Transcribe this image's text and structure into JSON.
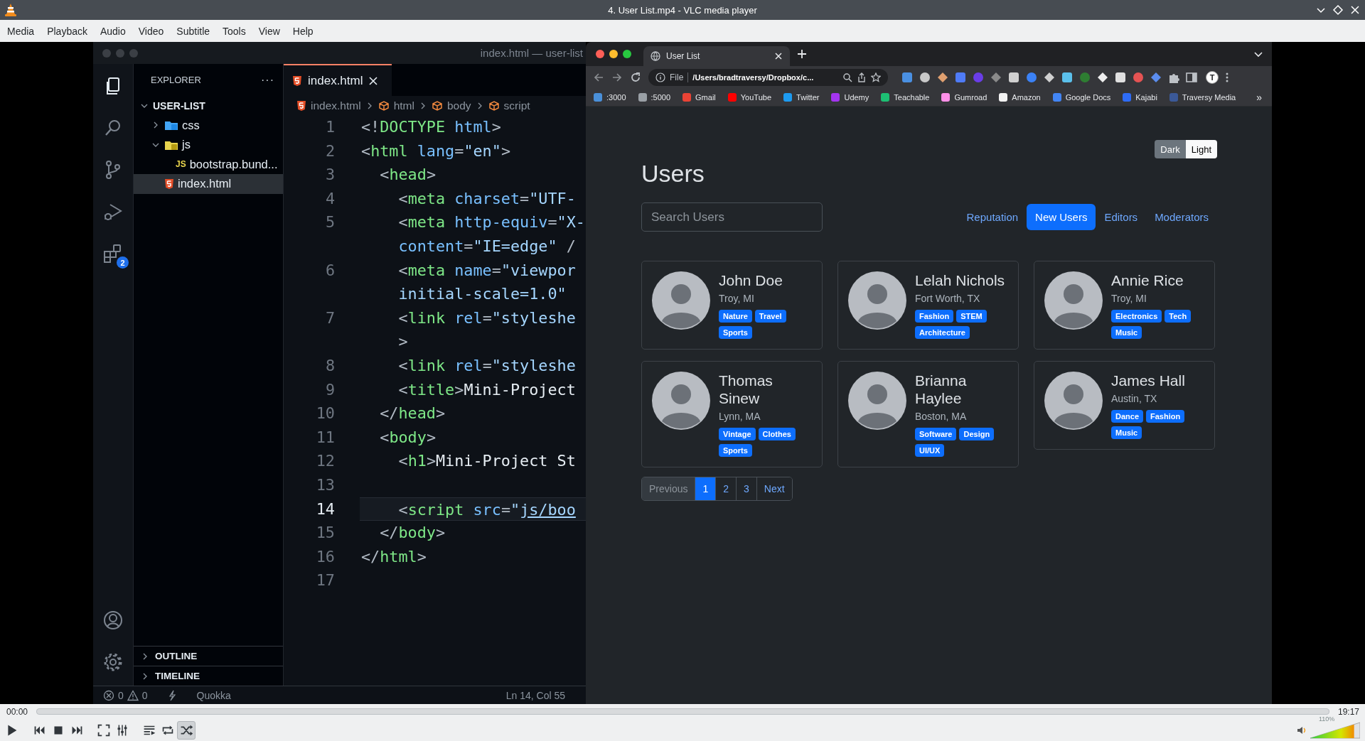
{
  "window": {
    "title": "4. User List.mp4 - VLC media player"
  },
  "menu": [
    "Media",
    "Playback",
    "Audio",
    "Video",
    "Subtitle",
    "Tools",
    "View",
    "Help"
  ],
  "editor": {
    "title": "index.html — user-list",
    "activity": [
      {
        "kind": "explorer",
        "selected": true
      },
      {
        "kind": "search",
        "selected": false
      },
      {
        "kind": "source-control",
        "selected": false
      },
      {
        "kind": "run-debug",
        "selected": false
      },
      {
        "kind": "extensions",
        "selected": false,
        "badge": "2"
      },
      {
        "kind": "account",
        "selected": false
      },
      {
        "kind": "settings",
        "selected": false
      }
    ],
    "explorer_title": "EXPLORER",
    "more": "···",
    "tree": [
      {
        "label": "USER-LIST",
        "kind": "root",
        "expanded": true,
        "selected": false,
        "children": [
          {
            "label": "css",
            "kind": "css-folder",
            "expanded": false,
            "selected": false
          },
          {
            "label": "js",
            "kind": "js-folder",
            "expanded": true,
            "selected": false,
            "children": [
              {
                "label": "bootstrap.bund...",
                "kind": "js-file",
                "icon": "JS",
                "selected": false
              }
            ]
          },
          {
            "label": "index.html",
            "kind": "html-file",
            "selected": true
          }
        ]
      }
    ],
    "sections": [
      {
        "label": "OUTLINE",
        "expanded": false
      },
      {
        "label": "TIMELINE",
        "expanded": false
      }
    ],
    "tabs": [
      {
        "label": "index.html",
        "selected": true
      }
    ],
    "breadcrumb": [
      {
        "kind": "file",
        "label": "index.html"
      },
      {
        "kind": "element",
        "label": "html"
      },
      {
        "kind": "element",
        "label": "body"
      },
      {
        "kind": "element",
        "label": "script"
      }
    ],
    "lines": [
      {
        "number": "1",
        "current": false,
        "tokens": [
          {
            "kind": "punct",
            "text": "<!"
          },
          {
            "kind": "tag",
            "text": "DOCTYPE"
          },
          {
            "kind": "attr",
            "text": " html"
          },
          {
            "kind": "punct",
            "text": ">"
          }
        ]
      },
      {
        "number": "2",
        "current": false,
        "tokens": [
          {
            "kind": "punct",
            "text": "<"
          },
          {
            "kind": "tag",
            "text": "html"
          },
          {
            "kind": "attr",
            "text": " lang"
          },
          {
            "kind": "punct",
            "text": "="
          },
          {
            "kind": "string",
            "text": "\"en\""
          },
          {
            "kind": "punct",
            "text": ">"
          }
        ]
      },
      {
        "number": "3",
        "current": false,
        "tokens": [
          {
            "kind": "punct",
            "text": "  <"
          },
          {
            "kind": "tag",
            "text": "head"
          },
          {
            "kind": "punct",
            "text": ">"
          }
        ]
      },
      {
        "number": "4",
        "current": false,
        "tokens": [
          {
            "kind": "punct",
            "text": "    <"
          },
          {
            "kind": "tag",
            "text": "meta"
          },
          {
            "kind": "attr",
            "text": " charset"
          },
          {
            "kind": "punct",
            "text": "="
          },
          {
            "kind": "string",
            "text": "\"UTF-"
          }
        ]
      },
      {
        "number": "5",
        "current": false,
        "tokens": [
          {
            "kind": "punct",
            "text": "    <"
          },
          {
            "kind": "tag",
            "text": "meta"
          },
          {
            "kind": "attr",
            "text": " http-equiv"
          },
          {
            "kind": "punct",
            "text": "="
          },
          {
            "kind": "string",
            "text": "\"X-"
          }
        ]
      },
      {
        "current": false,
        "tokens": [
          {
            "kind": "attr",
            "text": "    content"
          },
          {
            "kind": "punct",
            "text": "="
          },
          {
            "kind": "string",
            "text": "\"IE=edge\""
          },
          {
            "kind": "punct",
            "text": " /"
          }
        ]
      },
      {
        "number": "6",
        "current": false,
        "tokens": [
          {
            "kind": "punct",
            "text": "    <"
          },
          {
            "kind": "tag",
            "text": "meta"
          },
          {
            "kind": "attr",
            "text": " name"
          },
          {
            "kind": "punct",
            "text": "="
          },
          {
            "kind": "string",
            "text": "\"viewpor"
          }
        ]
      },
      {
        "current": false,
        "tokens": [
          {
            "kind": "string",
            "text": "    initial-scale=1.0\""
          }
        ]
      },
      {
        "number": "7",
        "current": false,
        "tokens": [
          {
            "kind": "punct",
            "text": "    <"
          },
          {
            "kind": "tag",
            "text": "link"
          },
          {
            "kind": "attr",
            "text": " rel"
          },
          {
            "kind": "punct",
            "text": "="
          },
          {
            "kind": "string",
            "text": "\"styleshe"
          }
        ]
      },
      {
        "current": false,
        "tokens": [
          {
            "kind": "punct",
            "text": "    >"
          }
        ]
      },
      {
        "number": "8",
        "current": false,
        "tokens": [
          {
            "kind": "punct",
            "text": "    <"
          },
          {
            "kind": "tag",
            "text": "link"
          },
          {
            "kind": "attr",
            "text": " rel"
          },
          {
            "kind": "punct",
            "text": "="
          },
          {
            "kind": "string",
            "text": "\"styleshe"
          }
        ]
      },
      {
        "number": "9",
        "current": false,
        "tokens": [
          {
            "kind": "punct",
            "text": "    <"
          },
          {
            "kind": "tag",
            "text": "title"
          },
          {
            "kind": "punct",
            "text": ">"
          },
          {
            "kind": "text",
            "text": "Mini-Project"
          }
        ]
      },
      {
        "number": "10",
        "current": false,
        "tokens": [
          {
            "kind": "punct",
            "text": "  </"
          },
          {
            "kind": "tag",
            "text": "head"
          },
          {
            "kind": "punct",
            "text": ">"
          }
        ]
      },
      {
        "number": "11",
        "current": false,
        "tokens": [
          {
            "kind": "punct",
            "text": "  <"
          },
          {
            "kind": "tag",
            "text": "body"
          },
          {
            "kind": "punct",
            "text": ">"
          }
        ]
      },
      {
        "number": "12",
        "current": false,
        "tokens": [
          {
            "kind": "punct",
            "text": "    <"
          },
          {
            "kind": "tag",
            "text": "h1"
          },
          {
            "kind": "punct",
            "text": ">"
          },
          {
            "kind": "text",
            "text": "Mini-Project St"
          }
        ]
      },
      {
        "number": "13",
        "current": false
      },
      {
        "number": "14",
        "current": true,
        "tokens": [
          {
            "kind": "punct",
            "text": "    <"
          },
          {
            "kind": "tag",
            "text": "script"
          },
          {
            "kind": "attr",
            "text": " src"
          },
          {
            "kind": "punct",
            "text": "="
          },
          {
            "kind": "string",
            "text": "\""
          },
          {
            "kind": "link",
            "text": "js/boo"
          }
        ]
      },
      {
        "number": "15",
        "current": false,
        "tokens": [
          {
            "kind": "punct",
            "text": "  </"
          },
          {
            "kind": "tag",
            "text": "body"
          },
          {
            "kind": "punct",
            "text": ">"
          }
        ]
      },
      {
        "number": "16",
        "current": false,
        "tokens": [
          {
            "kind": "punct",
            "text": "</"
          },
          {
            "kind": "tag",
            "text": "html"
          },
          {
            "kind": "punct",
            "text": ">"
          }
        ]
      },
      {
        "number": "17",
        "current": false
      }
    ],
    "status": {
      "errors": "0",
      "warnings": "0",
      "extension": "Quokka",
      "position": "Ln 14, Col 55"
    }
  },
  "browser": {
    "tabs": [
      {
        "title": "User List",
        "selected": true
      }
    ],
    "address": {
      "scheme": "File",
      "url": "/Users/bradtraversy/Dropbox/c..."
    },
    "profile": "T",
    "bookmarks": [
      {
        "label": ":3000",
        "color": "#4a90d9"
      },
      {
        "label": ":5000",
        "color": "#9aa0a6"
      },
      {
        "label": "Gmail",
        "color": "#ea4335"
      },
      {
        "label": "YouTube",
        "color": "#ff0000"
      },
      {
        "label": "Twitter",
        "color": "#1d9bf0"
      },
      {
        "label": "Udemy",
        "color": "#a435f0"
      },
      {
        "label": "Teachable",
        "color": "#1dbf73"
      },
      {
        "label": "Gumroad",
        "color": "#ff90e8"
      },
      {
        "label": "Amazon",
        "color": "#f2f2f2"
      },
      {
        "label": "Google Docs",
        "color": "#4285f4"
      },
      {
        "label": "Kajabi",
        "color": "#2e6cf6"
      },
      {
        "label": "Traversy Media",
        "color": "#3b5998"
      }
    ],
    "bookmarks_more": "»",
    "page": {
      "theme_toggle": [
        {
          "label": "Dark",
          "kind": "secondary"
        },
        {
          "label": "Light",
          "kind": "light"
        }
      ],
      "heading": "Users",
      "search": {
        "placeholder": "Search Users"
      },
      "filters": [
        {
          "label": "Reputation",
          "selected": false
        },
        {
          "label": "New Users",
          "selected": true
        },
        {
          "label": "Editors",
          "selected": false
        },
        {
          "label": "Moderators",
          "selected": false
        }
      ],
      "users": [
        {
          "name": "John Doe",
          "location": "Troy, MI",
          "tags": [
            "Nature",
            "Travel",
            "Sports"
          ]
        },
        {
          "name": "Lelah Nichols",
          "location": "Fort Worth, TX",
          "tags": [
            "Fashion",
            "STEM",
            "Architecture"
          ]
        },
        {
          "name": "Annie Rice",
          "location": "Troy, MI",
          "tags": [
            "Electronics",
            "Tech",
            "Music"
          ]
        },
        {
          "name": "Thomas Sinew",
          "location": "Lynn, MA",
          "tags": [
            "Vintage",
            "Clothes",
            "Sports"
          ]
        },
        {
          "name": "Brianna Haylee",
          "location": "Boston, MA",
          "tags": [
            "Software",
            "Design",
            "UI/UX"
          ]
        },
        {
          "name": "James Hall",
          "location": "Austin, TX",
          "tags": [
            "Dance",
            "Fashion",
            "Music"
          ]
        }
      ],
      "pagination": [
        {
          "label": "Previous",
          "disabled": true,
          "selected": false
        },
        {
          "label": "1",
          "disabled": false,
          "selected": true
        },
        {
          "label": "2",
          "disabled": false,
          "selected": false
        },
        {
          "label": "3",
          "disabled": false,
          "selected": false
        },
        {
          "label": "Next",
          "disabled": false,
          "selected": false
        }
      ]
    }
  },
  "player": {
    "elapsed": "00:00",
    "duration": "19:17",
    "seek": {
      "level": 0
    },
    "buttons": [
      {
        "kind": "play",
        "pressed": false
      },
      {
        "kind": "previous",
        "pressed": false
      },
      {
        "kind": "stop",
        "pressed": false
      },
      {
        "kind": "next",
        "pressed": false
      },
      {
        "kind": "fullscreen",
        "pressed": false
      },
      {
        "kind": "extended",
        "pressed": false
      },
      {
        "kind": "playlist",
        "pressed": false
      },
      {
        "kind": "loop",
        "pressed": false
      },
      {
        "kind": "shuffle",
        "pressed": true
      }
    ],
    "volume": {
      "level": 0.88,
      "reading": "110%"
    }
  }
}
